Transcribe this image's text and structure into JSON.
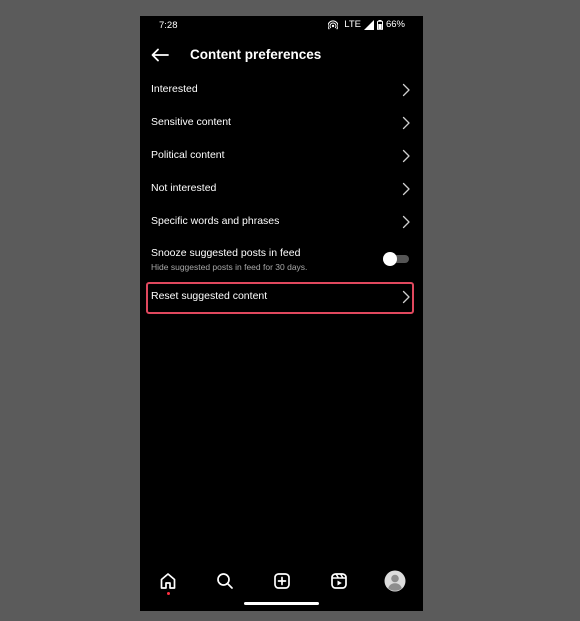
{
  "status_bar": {
    "time": "7:28",
    "network": "LTE",
    "battery": "66%"
  },
  "header": {
    "title": "Content preferences"
  },
  "menu": {
    "items": [
      {
        "label": "Interested"
      },
      {
        "label": "Sensitive content"
      },
      {
        "label": "Political content"
      },
      {
        "label": "Not interested"
      },
      {
        "label": "Specific words and phrases"
      }
    ],
    "snooze": {
      "title": "Snooze suggested posts in feed",
      "subtitle": "Hide suggested posts in feed for 30 days.",
      "enabled": false
    },
    "reset": {
      "label": "Reset suggested content"
    }
  },
  "bottom_nav": {
    "items": [
      "home-icon",
      "search-icon",
      "create-icon",
      "reels-icon",
      "profile-icon"
    ],
    "active": "home-icon"
  },
  "colors": {
    "background": "#000000",
    "highlight": "#e0485e",
    "secondary_text": "#a8a8a8"
  }
}
